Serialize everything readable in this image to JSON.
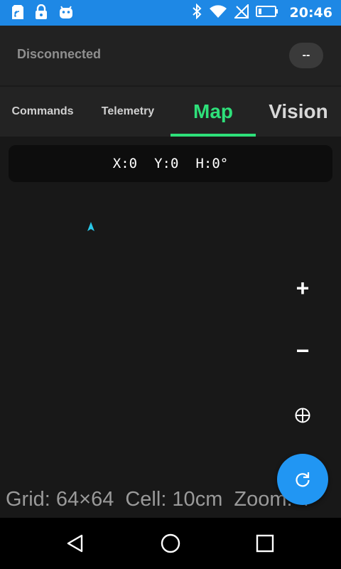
{
  "status_bar": {
    "time": "20:46",
    "left_icons": [
      "sim-card-icon",
      "lock-icon",
      "android-icon"
    ],
    "right_icons": [
      "bluetooth-icon",
      "wifi-icon",
      "no-signal-icon",
      "battery-icon"
    ]
  },
  "connection": {
    "status": "Disconnected",
    "indicator": "--"
  },
  "tabs": [
    {
      "label": "Commands",
      "selected": false
    },
    {
      "label": "Telemetry",
      "selected": false
    },
    {
      "label": "Map",
      "selected": true
    },
    {
      "label": "Vision",
      "selected": false
    }
  ],
  "map": {
    "pose": {
      "x": "X:0",
      "y": "Y:0",
      "h": "H:0°"
    },
    "controls": {
      "zoom_in": "+",
      "zoom_out": "−"
    },
    "info": {
      "grid": "Grid: 64×64",
      "cell": "Cell: 10cm",
      "zoom": "Zoom: 4"
    }
  },
  "colors": {
    "status_bar": "#1e88e5",
    "accent": "#2ee07a",
    "fab": "#2196f3",
    "robot_marker": "#29c7e8"
  }
}
